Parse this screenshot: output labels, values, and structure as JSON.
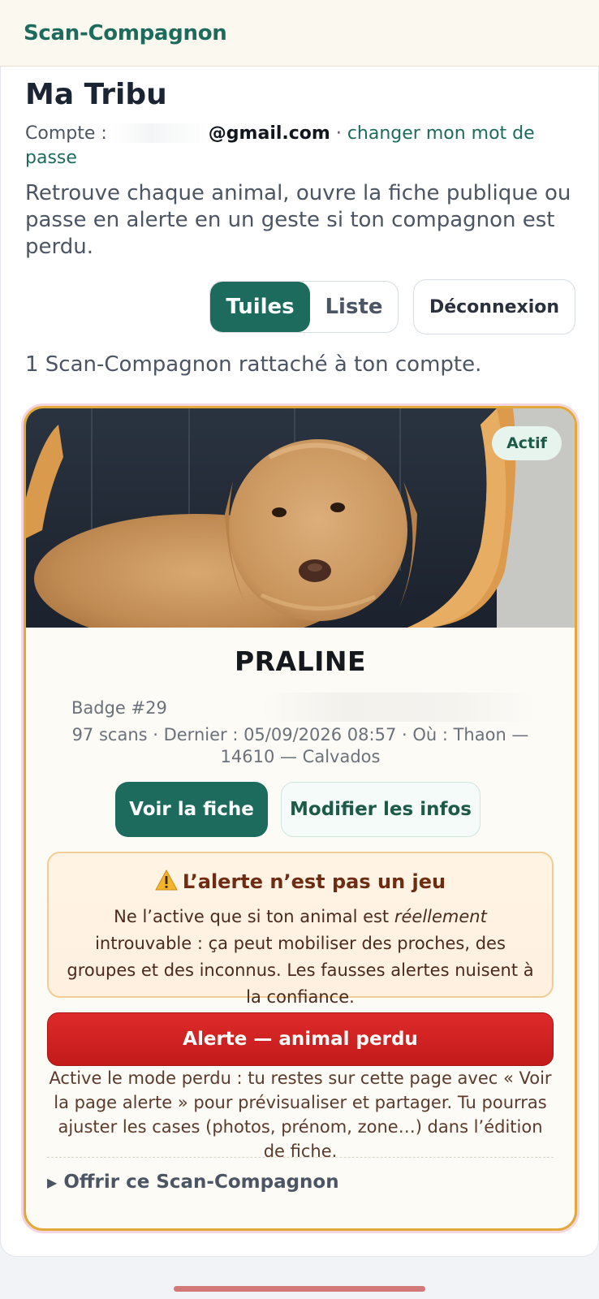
{
  "app": {
    "brand": "Scan-Compagnon"
  },
  "page": {
    "title": "Ma Tribu",
    "account_prefix": "Compte :",
    "account_email": "@gmail.com",
    "account_separator": " · ",
    "change_password_link": "changer mon mot de passe",
    "intro": "Retrouve chaque animal, ouvre la fiche publique ou passe en alerte en un geste si ton compagnon est perdu."
  },
  "view_toggle": {
    "tiles": "Tuiles",
    "list": "Liste",
    "selected": "Tuiles"
  },
  "logout_label": "Déconnexion",
  "count_text": "1 Scan-Compagnon rattaché à ton compte.",
  "pet": {
    "status": "Actif",
    "name": "PRALINE",
    "badge": "Badge #29",
    "scans_line": "97 scans · Dernier : 05/09/2026 08:57 · Où : Thaon — 14610 — Calvados",
    "view_button": "Voir la fiche",
    "edit_button": "Modifier les infos",
    "warning_title": "L’alerte n’est pas un jeu",
    "warning_text_1": "Ne l’active que si ton animal est ",
    "warning_text_em": "réellement",
    "warning_text_2": " introuvable : ça peut mobiliser des proches, des groupes et des inconnus. Les fausses alertes nuisent à la confiance.",
    "alert_button": "Alerte — animal perdu",
    "alert_help": "Active le mode perdu : tu restes sur cette page avec « Voir la page alerte » pour prévisualiser et partager. Tu pourras ajuster les cases (photos, prénom, zone…) dans l’édition de fiche.",
    "gift_label": "Offrir ce Scan-Compagnon"
  },
  "colors": {
    "brand": "#1d6b5d",
    "alert": "#d42222",
    "card_border": "#e2a93a"
  },
  "icons": {
    "warning": "warning-triangle-icon",
    "gift_toggle": "caret-right-icon"
  }
}
